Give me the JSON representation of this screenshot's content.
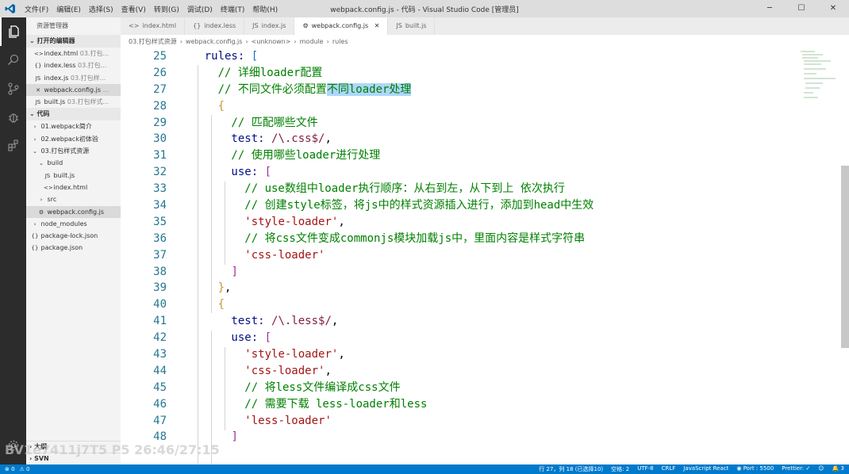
{
  "titlebar": {
    "menu": [
      "文件(F)",
      "编辑(E)",
      "选择(S)",
      "查看(V)",
      "转到(G)",
      "调试(D)",
      "终端(T)",
      "帮助(H)"
    ],
    "title": "webpack.config.js - 代码 - Visual Studio Code [管理员]",
    "minimize": "─",
    "maximize": "☐",
    "close": "✕"
  },
  "activity": {
    "explorer_icon": "files-icon",
    "search_icon": "search-icon",
    "scm_icon": "source-control-icon",
    "debug_icon": "debug-icon",
    "ext_icon": "extensions-icon",
    "settings_icon": "gear-icon"
  },
  "sidebar": {
    "title": "资源管理器",
    "open_editors_label": "打开的编辑器",
    "open_editors": [
      {
        "icon": "<>",
        "name": "index.html",
        "dim": "03.打包..."
      },
      {
        "icon": "{}",
        "name": "index.less",
        "dim": "03.打包..."
      },
      {
        "icon": "JS",
        "name": "index.js",
        "dim": "03.打包样..."
      },
      {
        "icon": "✕",
        "name": "webpack.config.js",
        "dim": "..."
      },
      {
        "icon": "JS",
        "name": "built.js",
        "dim": "03.打包样式..."
      }
    ],
    "project_label": "代码",
    "tree": [
      {
        "icon": "›",
        "name": "01.webpack简介",
        "indent": 6
      },
      {
        "icon": "›",
        "name": "02.webpack初体验",
        "indent": 6
      },
      {
        "icon": "⌄",
        "name": "03.打包样式资源",
        "indent": 6
      },
      {
        "icon": "⌄",
        "name": "build",
        "indent": 14
      },
      {
        "icon": "JS",
        "name": "built.js",
        "indent": 22
      },
      {
        "icon": "<>",
        "name": "index.html",
        "indent": 22
      },
      {
        "icon": "›",
        "name": "src",
        "indent": 14
      },
      {
        "icon": "⚙",
        "name": "webpack.config.js",
        "indent": 14
      },
      {
        "icon": "›",
        "name": "node_modules",
        "indent": 6
      },
      {
        "icon": "{}",
        "name": "package-lock.json",
        "indent": 6
      },
      {
        "icon": "{}",
        "name": "package.json",
        "indent": 6
      }
    ],
    "outline_label": "大纲",
    "svn_label": "SVN"
  },
  "tabs": [
    {
      "icon": "<>",
      "label": "index.html",
      "active": false
    },
    {
      "icon": "{}",
      "label": "index.less",
      "active": false
    },
    {
      "icon": "JS",
      "label": "index.js",
      "active": false
    },
    {
      "icon": "⚙",
      "label": "webpack.config.js",
      "active": true,
      "close": "✕"
    },
    {
      "icon": "JS",
      "label": "built.js",
      "active": false
    }
  ],
  "breadcrumb": [
    "03.打包样式资源",
    "›",
    "webpack.config.js",
    "›",
    "<unknown>",
    "›",
    "module",
    "›",
    "rules"
  ],
  "editor": {
    "line_numbers": [
      "25",
      "26",
      "27",
      "28",
      "29",
      "30",
      "31",
      "32",
      "33",
      "34",
      "35",
      "36",
      "37",
      "38",
      "39",
      "40",
      "41",
      "42",
      "43",
      "44",
      "45",
      "46",
      "47",
      "48"
    ],
    "lines": [
      [
        {
          "t": "    rules: ",
          "c": "tok-key"
        },
        {
          "t": "[",
          "c": "tok-br3"
        }
      ],
      [
        {
          "t": "      // 详细loader配置",
          "c": "tok-com"
        }
      ],
      [
        {
          "t": "      // 不同文件必须配置",
          "c": "tok-com"
        },
        {
          "t": "不同loader处理",
          "c": "tok-com tok-sel"
        }
      ],
      [
        {
          "t": "      ",
          "c": ""
        },
        {
          "t": "{",
          "c": "tok-br1"
        }
      ],
      [
        {
          "t": "        // 匹配哪些文件",
          "c": "tok-com"
        }
      ],
      [
        {
          "t": "        test: ",
          "c": "tok-key"
        },
        {
          "t": "/\\.css$/",
          "c": "tok-re"
        },
        {
          "t": ",",
          "c": ""
        }
      ],
      [
        {
          "t": "        // 使用哪些loader进行处理",
          "c": "tok-com"
        }
      ],
      [
        {
          "t": "        use: ",
          "c": "tok-key"
        },
        {
          "t": "[",
          "c": "tok-br2"
        }
      ],
      [
        {
          "t": "          // use数组中loader执行顺序：从右到左，从下到上 依次执行",
          "c": "tok-com"
        }
      ],
      [
        {
          "t": "          // 创建style标签，将js中的样式资源插入进行，添加到head中生效",
          "c": "tok-com"
        }
      ],
      [
        {
          "t": "          ",
          "c": ""
        },
        {
          "t": "'style-loader'",
          "c": "tok-str"
        },
        {
          "t": ",",
          "c": ""
        }
      ],
      [
        {
          "t": "          // 将css文件变成commonjs模块加载js中，里面内容是样式字符串",
          "c": "tok-com"
        }
      ],
      [
        {
          "t": "          ",
          "c": ""
        },
        {
          "t": "'css-loader'",
          "c": "tok-str"
        }
      ],
      [
        {
          "t": "        ",
          "c": ""
        },
        {
          "t": "]",
          "c": "tok-br2"
        }
      ],
      [
        {
          "t": "      ",
          "c": ""
        },
        {
          "t": "}",
          "c": "tok-br1"
        },
        {
          "t": ",",
          "c": ""
        }
      ],
      [
        {
          "t": "      ",
          "c": ""
        },
        {
          "t": "{",
          "c": "tok-br1"
        }
      ],
      [
        {
          "t": "        test: ",
          "c": "tok-key"
        },
        {
          "t": "/\\.less$/",
          "c": "tok-re"
        },
        {
          "t": ",",
          "c": ""
        }
      ],
      [
        {
          "t": "        use: ",
          "c": "tok-key"
        },
        {
          "t": "[",
          "c": "tok-br2"
        }
      ],
      [
        {
          "t": "          ",
          "c": ""
        },
        {
          "t": "'style-loader'",
          "c": "tok-str"
        },
        {
          "t": ",",
          "c": ""
        }
      ],
      [
        {
          "t": "          ",
          "c": ""
        },
        {
          "t": "'css-loader'",
          "c": "tok-str"
        },
        {
          "t": ",",
          "c": ""
        }
      ],
      [
        {
          "t": "          // 将less文件编译成css文件",
          "c": "tok-com"
        }
      ],
      [
        {
          "t": "          // 需要下载 less-loader和less",
          "c": "tok-com"
        }
      ],
      [
        {
          "t": "          ",
          "c": ""
        },
        {
          "t": "'less-loader'",
          "c": "tok-str"
        }
      ],
      [
        {
          "t": "        ",
          "c": ""
        },
        {
          "t": "]",
          "c": "tok-br2"
        }
      ]
    ]
  },
  "statusbar": {
    "errors": "⊗ 0",
    "warnings": "⚠ 0",
    "position": "行 27，列 18 (已选择10)",
    "spaces": "空格: 2",
    "encoding": "UTF-8",
    "eol": "CRLF",
    "language": "JavaScript React",
    "port": "◉ Port : 5500",
    "prettier": "Prettier: ✓",
    "feedback": "☺",
    "notifications": "🔔 3"
  },
  "watermark": "BV1e7411j7T5 P5 26:46/27:15"
}
